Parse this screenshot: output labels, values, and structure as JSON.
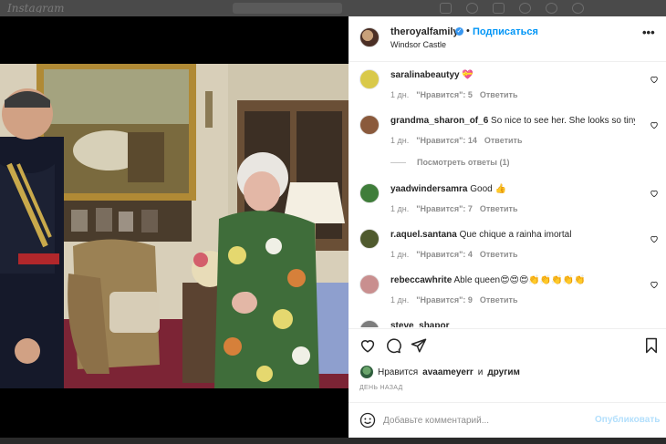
{
  "post": {
    "username": "theroyalfamily",
    "separator": "•",
    "follow_label": "Подписаться",
    "location": "Windsor Castle",
    "more_label": "•••"
  },
  "comments": [
    {
      "user": "saralinabeautyy",
      "text": "💝",
      "time": "1 дн.",
      "likes": "\"Нравится\": 5",
      "reply": "Ответить",
      "avatar_color": "#d9c94a"
    },
    {
      "user": "grandma_sharon_of_6",
      "text": "So nice to see her. She looks so tiny.",
      "time": "1 дн.",
      "likes": "\"Нравится\": 14",
      "reply": "Ответить",
      "avatar_color": "#8a5a3c"
    },
    {
      "user": "yaadwindersamra",
      "text": "Good 👍",
      "time": "1 дн.",
      "likes": "\"Нравится\": 7",
      "reply": "Ответить",
      "avatar_color": "#3f7d3a"
    },
    {
      "user": "r.aquel.santana",
      "text": "Que chique a rainha imortal",
      "time": "1 дн.",
      "likes": "\"Нравится\": 4",
      "reply": "Ответить",
      "avatar_color": "#4f5a2e"
    },
    {
      "user": "rebeccawhrite",
      "text": "Able queen😍😍😍👏👏👏👏👏",
      "time": "1 дн.",
      "likes": "\"Нравится\": 9",
      "reply": "Ответить",
      "avatar_color": "#c98f8f"
    },
    {
      "user": "steve_shapor",
      "text": "",
      "time": "",
      "likes": "",
      "reply": "",
      "avatar_color": "#7d7d7d"
    }
  ],
  "view_replies": "Посмотреть ответы (1)",
  "likes_line": {
    "prefix": "Нравится",
    "user": "avaameyerr",
    "conj": "и",
    "others": "другим"
  },
  "posted_ago": "ДЕНЬ НАЗАД",
  "add_comment": {
    "placeholder": "Добавьте комментарий...",
    "post_label": "Опубликовать"
  },
  "background_app": {
    "logo": "Instagram"
  },
  "colors": {
    "link_blue": "#0095f6",
    "post_disabled": "#b2dffc",
    "muted": "#8e8e8e"
  }
}
